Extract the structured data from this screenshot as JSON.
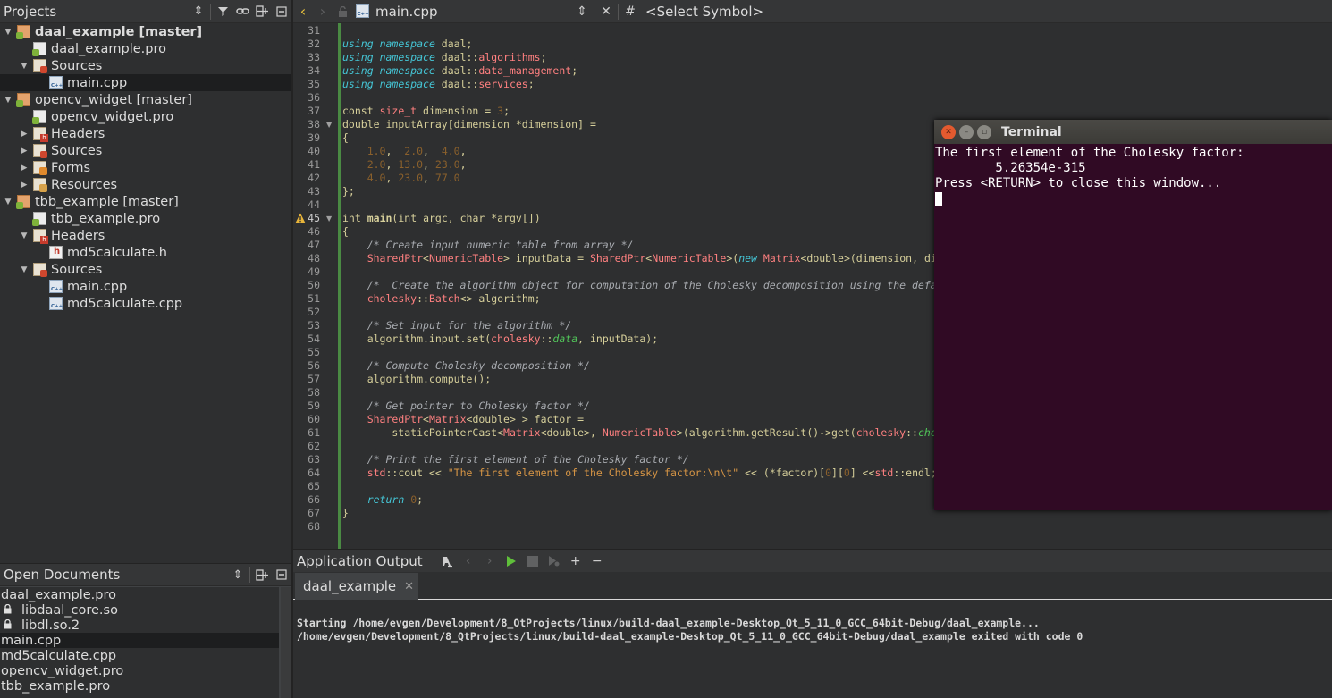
{
  "projects_panel": {
    "title": "Projects",
    "tree": [
      {
        "label": "daal_example [master]",
        "icon": "qt-project-icon",
        "bold": true,
        "arrow": "open",
        "indent": 0
      },
      {
        "label": "daal_example.pro",
        "icon": "pro-file-icon",
        "arrow": "",
        "indent": 1
      },
      {
        "label": "Sources",
        "icon": "sources-folder-icon",
        "arrow": "open",
        "indent": 1
      },
      {
        "label": "main.cpp",
        "icon": "cpp-file-icon",
        "arrow": "",
        "indent": 2,
        "selected": true
      },
      {
        "label": "opencv_widget [master]",
        "icon": "qt-project-icon",
        "arrow": "open",
        "indent": 0
      },
      {
        "label": "opencv_widget.pro",
        "icon": "pro-file-icon",
        "arrow": "",
        "indent": 1
      },
      {
        "label": "Headers",
        "icon": "headers-folder-icon",
        "arrow": "closed",
        "indent": 1
      },
      {
        "label": "Sources",
        "icon": "sources-folder-icon",
        "arrow": "closed",
        "indent": 1
      },
      {
        "label": "Forms",
        "icon": "forms-folder-icon",
        "arrow": "closed",
        "indent": 1
      },
      {
        "label": "Resources",
        "icon": "resources-folder-icon",
        "arrow": "closed",
        "indent": 1
      },
      {
        "label": "tbb_example [master]",
        "icon": "qt-project-icon",
        "arrow": "open",
        "indent": 0
      },
      {
        "label": "tbb_example.pro",
        "icon": "pro-file-icon",
        "arrow": "",
        "indent": 1
      },
      {
        "label": "Headers",
        "icon": "headers-folder-icon",
        "arrow": "open",
        "indent": 1
      },
      {
        "label": "md5calculate.h",
        "icon": "header-file-icon",
        "arrow": "",
        "indent": 2
      },
      {
        "label": "Sources",
        "icon": "sources-folder-icon",
        "arrow": "open",
        "indent": 1
      },
      {
        "label": "main.cpp",
        "icon": "cpp-file-icon",
        "arrow": "",
        "indent": 2
      },
      {
        "label": "md5calculate.cpp",
        "icon": "cpp-file-icon",
        "arrow": "",
        "indent": 2
      }
    ]
  },
  "open_documents": {
    "title": "Open Documents",
    "items": [
      {
        "label": "daal_example.pro",
        "locked": false
      },
      {
        "label": "libdaal_core.so",
        "locked": true
      },
      {
        "label": "libdl.so.2",
        "locked": true
      },
      {
        "label": "main.cpp",
        "locked": false,
        "selected": true
      },
      {
        "label": "md5calculate.cpp",
        "locked": false
      },
      {
        "label": "opencv_widget.pro",
        "locked": false
      },
      {
        "label": "tbb_example.pro",
        "locked": false
      }
    ]
  },
  "editor": {
    "file_name": "main.cpp",
    "symbol_placeholder": "<Select Symbol>",
    "hash_label": "#",
    "current_line": 45,
    "warning_line": 45,
    "fold_lines": [
      38,
      45
    ],
    "lines": [
      {
        "n": 31,
        "html": ""
      },
      {
        "n": 32,
        "html": "<span class='kw'>using</span> <span class='kw'>namespace</span> daal;"
      },
      {
        "n": 33,
        "html": "<span class='kw'>using</span> <span class='kw'>namespace</span> daal::<span class='ty'>algorithms</span>;"
      },
      {
        "n": 34,
        "html": "<span class='kw'>using</span> <span class='kw'>namespace</span> daal::<span class='ty'>data_management</span>;"
      },
      {
        "n": 35,
        "html": "<span class='kw'>using</span> <span class='kw'>namespace</span> daal::<span class='ty'>services</span>;"
      },
      {
        "n": 36,
        "html": ""
      },
      {
        "n": 37,
        "html": "<span class='kw2'>const</span> <span class='ty'>size_t</span> dimension = <span class='num'>3</span>;"
      },
      {
        "n": 38,
        "html": "<span class='kw2'>double</span> inputArray[dimension *dimension] ="
      },
      {
        "n": 39,
        "html": "{"
      },
      {
        "n": 40,
        "html": "    <span class='num'>1.0</span>,  <span class='num'>2.0</span>,  <span class='num'>4.0</span>,"
      },
      {
        "n": 41,
        "html": "    <span class='num'>2.0</span>, <span class='num'>13.0</span>, <span class='num'>23.0</span>,"
      },
      {
        "n": 42,
        "html": "    <span class='num'>4.0</span>, <span class='num'>23.0</span>, <span class='num'>77.0</span>"
      },
      {
        "n": 43,
        "html": "};"
      },
      {
        "n": 44,
        "html": ""
      },
      {
        "n": 45,
        "html": "<span class='kw2'>int</span> <span class='fn'>main</span>(<span class='kw2'>int</span> argc, <span class='kw2'>char</span> *argv[])"
      },
      {
        "n": 46,
        "html": "{"
      },
      {
        "n": 47,
        "html": "    <span class='cm'>/* Create input numeric table from array */</span>"
      },
      {
        "n": 48,
        "html": "    <span class='ty'>SharedPtr</span>&lt;<span class='ty'>NumericTable</span>&gt; inputData = <span class='ty'>SharedPtr</span>&lt;<span class='ty'>NumericTable</span>&gt;(<span class='kw'>new</span> <span class='ty'>Matrix</span>&lt;<span class='kw2'>double</span>&gt;(dimension, dimension, inputArray));"
      },
      {
        "n": 49,
        "html": ""
      },
      {
        "n": 50,
        "html": "    <span class='cm'>/*  Create the algorithm object for computation of the Cholesky decomposition using the default method */</span>"
      },
      {
        "n": 51,
        "html": "    <span class='ty'>cholesky</span>::<span class='ty'>Batch</span>&lt;&gt; algorithm;"
      },
      {
        "n": 52,
        "html": ""
      },
      {
        "n": 53,
        "html": "    <span class='cm'>/* Set input for the algorithm */</span>"
      },
      {
        "n": 54,
        "html": "    algorithm.input.set(<span class='ty'>cholesky</span>::<span class='enm'>data</span>, inputData);"
      },
      {
        "n": 55,
        "html": ""
      },
      {
        "n": 56,
        "html": "    <span class='cm'>/* Compute Cholesky decomposition */</span>"
      },
      {
        "n": 57,
        "html": "    algorithm.compute();"
      },
      {
        "n": 58,
        "html": ""
      },
      {
        "n": 59,
        "html": "    <span class='cm'>/* Get pointer to Cholesky factor */</span>"
      },
      {
        "n": 60,
        "html": "    <span class='ty'>SharedPtr</span>&lt;<span class='ty'>Matrix</span>&lt;<span class='kw2'>double</span>&gt; &gt; factor ="
      },
      {
        "n": 61,
        "html": "        staticPointerCast&lt;<span class='ty'>Matrix</span>&lt;<span class='kw2'>double</span>&gt;, <span class='ty'>NumericTable</span>&gt;(algorithm.getResult()-&gt;get(<span class='ty'>cholesky</span>::<span class='enm'>choleskyFactor</span>));"
      },
      {
        "n": 62,
        "html": ""
      },
      {
        "n": 63,
        "html": "    <span class='cm'>/* Print the first element of the Cholesky factor */</span>"
      },
      {
        "n": 64,
        "html": "    <span class='ty'>std</span>::cout &lt;&lt; <span class='str'>\"The first element of the Cholesky factor:\\n\\t\"</span> &lt;&lt; (*factor)[<span class='num'>0</span>][<span class='num'>0</span>] &lt;&lt;<span class='ty'>std</span>::endl;"
      },
      {
        "n": 65,
        "html": ""
      },
      {
        "n": 66,
        "html": "    <span class='kw'>return</span> <span class='num'>0</span>;"
      },
      {
        "n": 67,
        "html": "}"
      },
      {
        "n": 68,
        "html": ""
      }
    ]
  },
  "terminal": {
    "title": "Terminal",
    "lines": [
      "The first element of the Cholesky factor:",
      "        5.26354e-315",
      "Press <RETURN> to close this window..."
    ]
  },
  "output": {
    "title": "Application Output",
    "tab_label": "daal_example",
    "lines": [
      "Starting /home/evgen/Development/8_QtProjects/linux/build-daal_example-Desktop_Qt_5_11_0_GCC_64bit-Debug/daal_example...",
      "/home/evgen/Development/8_QtProjects/linux/build-daal_example-Desktop_Qt_5_11_0_GCC_64bit-Debug/daal_example exited with code 0"
    ]
  },
  "colors": {
    "terminal_bg": "#300a24",
    "editor_bg": "#2e2f30",
    "panel_bg": "#404244",
    "modified_bar": "#4a8a43",
    "keyword": "#45c6d6"
  }
}
